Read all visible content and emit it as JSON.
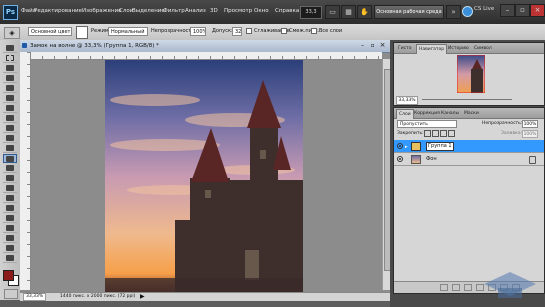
{
  "app": {
    "logo": "Ps",
    "zoom": "33,3",
    "workspace": "Основная рабочая среда",
    "cs_live": "CS Live"
  },
  "menu": [
    "Файл",
    "Редактирование",
    "Изображение",
    "Слои",
    "Выделение",
    "Фильтр",
    "Анализ",
    "3D",
    "Просмотр",
    "Окно",
    "Справка"
  ],
  "options": {
    "style_label": "Основной цвет",
    "mode_label": "Режим:",
    "mode_value": "Нормальный",
    "opacity_label": "Непрозрачность:",
    "opacity_value": "100%",
    "tolerance_label": "Допуск:",
    "tolerance_value": "32",
    "antialias": "Сглаживание",
    "contiguous": "Смеж.пикс.",
    "all_layers": "Все слои"
  },
  "document": {
    "title": "Замок на волне @ 33,3% (Группа 1, RGB/8) *",
    "status_zoom": "33,33%",
    "status_info": "1440 пикс. x 2000 пикс. (72 ppi)"
  },
  "navigator": {
    "tabs": [
      "Гисто",
      "Навигатор",
      "Историю",
      "Символ"
    ],
    "zoom": "33,33%"
  },
  "layers": {
    "tabs": [
      "Слои",
      "Коррекция",
      "Каналы",
      "Маски"
    ],
    "blend": "Пропустить",
    "opacity_label": "Непрозрачность:",
    "opacity_value": "100%",
    "lock_label": "Закрепить:",
    "fill_label": "Заливка:",
    "fill_value": "100%",
    "items": [
      {
        "name": "Группа 1",
        "selected": true
      },
      {
        "name": "Фон",
        "selected": false
      }
    ]
  },
  "colors": {
    "accent": "#3399ff",
    "menubar": "#3a3a3a",
    "panel": "#d6d6d6",
    "foreground": "#8b1a1a"
  }
}
